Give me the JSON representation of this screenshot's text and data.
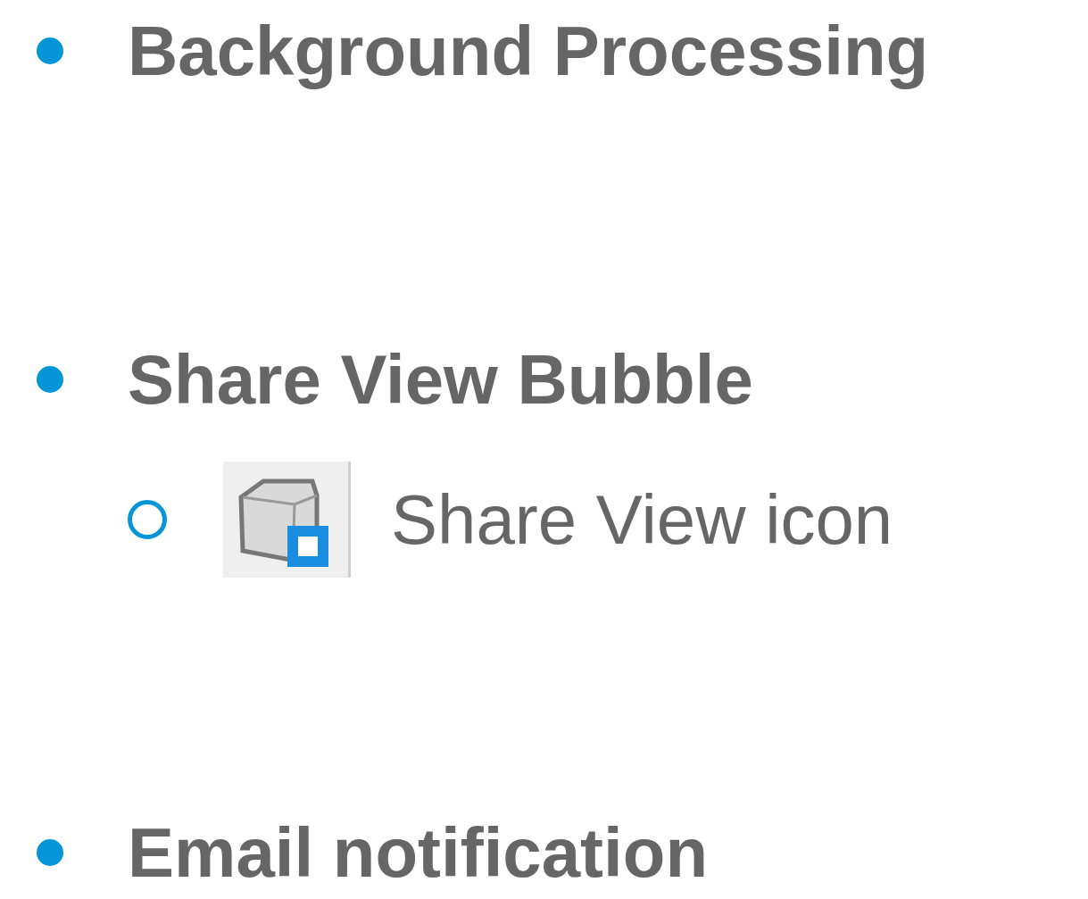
{
  "list": [
    {
      "text": "Background Processing"
    },
    {
      "text": "Share View Bubble",
      "children": [
        {
          "text": "Share View icon",
          "icon": true
        }
      ]
    },
    {
      "text": "Email notification"
    }
  ]
}
